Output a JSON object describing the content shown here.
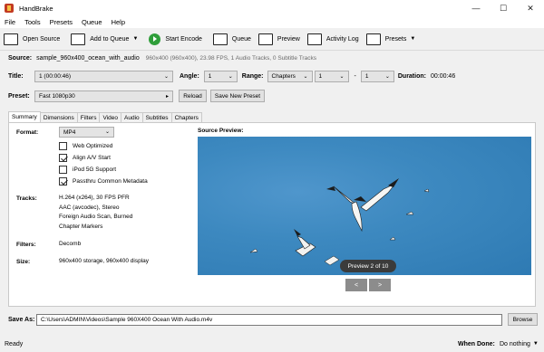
{
  "window": {
    "title": "HandBrake",
    "minimize": "—",
    "maximize": "☐",
    "close": "✕"
  },
  "menu": [
    "File",
    "Tools",
    "Presets",
    "Queue",
    "Help"
  ],
  "toolbar": {
    "open_source": "Open Source",
    "add_to_queue": "Add to Queue",
    "start_encode": "Start Encode",
    "queue": "Queue",
    "preview": "Preview",
    "activity_log": "Activity Log",
    "presets": "Presets"
  },
  "source": {
    "label": "Source:",
    "name": "sample_960x400_ocean_with_audio",
    "info": "960x400 (960x400), 23.98 FPS, 1 Audio Tracks, 0 Subtitle Tracks"
  },
  "title_row": {
    "title_label": "Title:",
    "title_value": "1 (00:00:46)",
    "angle_label": "Angle:",
    "angle_value": "1",
    "range_label": "Range:",
    "range_type": "Chapters",
    "range_start": "1",
    "range_sep": "-",
    "range_end": "1",
    "duration_label": "Duration:",
    "duration_value": "00:00:46"
  },
  "preset_row": {
    "label": "Preset:",
    "value": "Fast 1080p30",
    "reload": "Reload",
    "save_new": "Save New Preset"
  },
  "tabs": [
    "Summary",
    "Dimensions",
    "Filters",
    "Video",
    "Audio",
    "Subtitles",
    "Chapters"
  ],
  "summary": {
    "format_label": "Format:",
    "format_value": "MP4",
    "options": [
      {
        "label": "Web Optimized",
        "checked": false
      },
      {
        "label": "Align A/V Start",
        "checked": true
      },
      {
        "label": "iPod 5G Support",
        "checked": false
      },
      {
        "label": "Passthru Common Metadata",
        "checked": true
      }
    ],
    "tracks_label": "Tracks:",
    "tracks": [
      "H.264 (x264), 30 FPS PFR",
      "AAC (avcodec), Stereo",
      "Foreign Audio Scan, Burned",
      "Chapter Markers"
    ],
    "filters_label": "Filters:",
    "filters_value": "Decomb",
    "size_label": "Size:",
    "size_value": "960x400 storage, 960x400 display",
    "source_preview_label": "Source Preview:",
    "preview_counter": "Preview 2 of 10",
    "prev_btn": "<",
    "next_btn": ">"
  },
  "save_as": {
    "label": "Save As:",
    "path": "C:\\Users\\ADMIN\\Videos\\Sample 960X400 Ocean With Audio.m4v",
    "browse": "Browse"
  },
  "status": {
    "text": "Ready",
    "when_done_label": "When Done:",
    "when_done_value": "Do nothing"
  }
}
